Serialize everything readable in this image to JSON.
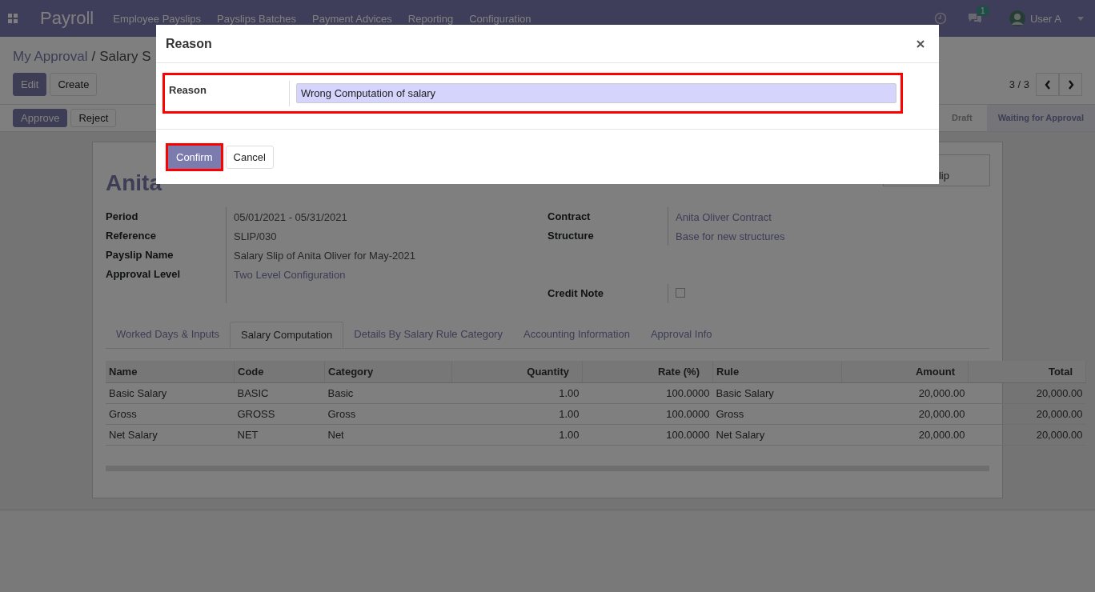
{
  "navbar": {
    "app_name": "Payroll",
    "menu": [
      "Employee Payslips",
      "Payslips Batches",
      "Payment Advices",
      "Reporting",
      "Configuration"
    ],
    "message_count": "1",
    "user": "User A"
  },
  "breadcrumb": [
    "My Approval",
    "Salary S"
  ],
  "breadcrumb_separator": "/",
  "buttons": [
    {
      "label": "Edit",
      "kind": "primary"
    },
    {
      "label": "Create",
      "kind": "secondary"
    }
  ],
  "pager": "3 / 3",
  "actions": [
    {
      "label": "Approve",
      "kind": "primary"
    },
    {
      "label": "Reject",
      "kind": "secondary"
    }
  ],
  "statusbar": [
    {
      "label": "Draft",
      "selected": false
    },
    {
      "label": "Waiting for Approval",
      "selected": true
    }
  ],
  "sheet": {
    "title": "Anita",
    "smart_button": "lip",
    "fields_left": [
      {
        "label": "Period",
        "value": "05/01/2021 - 05/31/2021",
        "kind": "text"
      },
      {
        "label": "Reference",
        "value": "SLIP/030",
        "kind": "text"
      },
      {
        "label": "Payslip Name",
        "value": "Salary Slip of Anita Oliver for May-2021",
        "kind": "text"
      },
      {
        "label": "Approval Level",
        "value": "Two Level Configuration",
        "kind": "link"
      }
    ],
    "fields_right": [
      {
        "label": "Contract",
        "value": "Anita Oliver Contract",
        "kind": "link"
      },
      {
        "label": "Structure",
        "value": "Base for new structures",
        "kind": "link"
      },
      {
        "label": "Credit Note",
        "checked": false,
        "kind": "checkbox"
      }
    ],
    "tabs": [
      {
        "label": "Worked Days & Inputs",
        "selected": false
      },
      {
        "label": "Salary Computation",
        "selected": true
      },
      {
        "label": "Details By Salary Rule Category",
        "selected": false
      },
      {
        "label": "Accounting Information",
        "selected": false
      },
      {
        "label": "Approval Info",
        "selected": false
      }
    ],
    "table": {
      "columns": [
        {
          "label": "Name",
          "kind": "text"
        },
        {
          "label": "Code",
          "kind": "text"
        },
        {
          "label": "Category",
          "kind": "text"
        },
        {
          "label": "Quantity",
          "kind": "number"
        },
        {
          "label": "Rate (%)",
          "kind": "number"
        },
        {
          "label": "Rule",
          "kind": "text"
        },
        {
          "label": "Amount",
          "kind": "number"
        },
        {
          "label": "Total",
          "kind": "number"
        }
      ],
      "rows": [
        [
          "Basic Salary",
          "BASIC",
          "Basic",
          "1.00",
          "100.0000",
          "Basic Salary",
          "20,000.00",
          "20,000.00"
        ],
        [
          "Gross",
          "GROSS",
          "Gross",
          "1.00",
          "100.0000",
          "Gross",
          "20,000.00",
          "20,000.00"
        ],
        [
          "Net Salary",
          "NET",
          "Net",
          "1.00",
          "100.0000",
          "Net Salary",
          "20,000.00",
          "20,000.00"
        ]
      ]
    }
  },
  "dialog": {
    "title": "Reason",
    "field_label": "Reason",
    "field_value": "Wrong Computation of salary",
    "buttons": [
      {
        "label": "Confirm",
        "kind": "primary"
      },
      {
        "label": "Cancel",
        "kind": "secondary"
      }
    ]
  }
}
